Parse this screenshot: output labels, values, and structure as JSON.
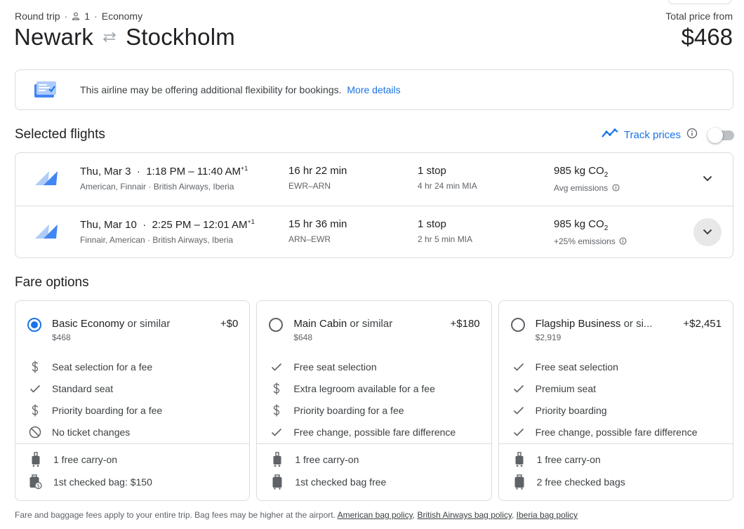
{
  "trip": {
    "type": "Round trip",
    "passengers": "1",
    "cabin": "Economy",
    "origin": "Newark",
    "destination": "Stockholm"
  },
  "price": {
    "label": "Total price from",
    "value": "$468"
  },
  "banner": {
    "text": "This airline may be offering additional flexibility for bookings.",
    "link": "More details"
  },
  "selected_flights": {
    "title": "Selected flights",
    "track_label": "Track prices",
    "track_enabled": false,
    "flights": [
      {
        "date": "Thu, Mar 3",
        "times": "1:18 PM – 11:40 AM",
        "day_offset": "+1",
        "airlines": "American, Finnair · British Airways, Iberia",
        "duration": "16 hr 22 min",
        "route": "EWR–ARN",
        "stops": "1 stop",
        "layover": "4 hr 24 min MIA",
        "emissions": "985 kg CO",
        "emissions_sub": "2",
        "emissions_note": "Avg emissions"
      },
      {
        "date": "Thu, Mar 10",
        "times": "2:25 PM – 12:01 AM",
        "day_offset": "+1",
        "airlines": "Finnair, American · British Airways, Iberia",
        "duration": "15 hr 36 min",
        "route": "ARN–EWR",
        "stops": "1 stop",
        "layover": "2 hr 5 min MIA",
        "emissions": "985 kg CO",
        "emissions_sub": "2",
        "emissions_note": "+25% emissions"
      }
    ]
  },
  "fare_options": {
    "title": "Fare options",
    "cards": [
      {
        "name": "Basic Economy",
        "suffix": "or similar",
        "price": "$468",
        "delta": "+$0",
        "selected": true,
        "features": [
          {
            "icon": "dollar-icon",
            "text": "Seat selection for a fee"
          },
          {
            "icon": "check-icon",
            "text": "Standard seat"
          },
          {
            "icon": "dollar-icon",
            "text": "Priority boarding for a fee"
          },
          {
            "icon": "no-icon",
            "text": "No ticket changes"
          }
        ],
        "bags": [
          {
            "icon": "carry-on-icon",
            "text": "1 free carry-on"
          },
          {
            "icon": "checked-bag-fee-icon",
            "text": "1st checked bag: $150"
          }
        ]
      },
      {
        "name": "Main Cabin",
        "suffix": "or similar",
        "price": "$648",
        "delta": "+$180",
        "selected": false,
        "features": [
          {
            "icon": "check-icon",
            "text": "Free seat selection"
          },
          {
            "icon": "dollar-icon",
            "text": "Extra legroom available for a fee"
          },
          {
            "icon": "dollar-icon",
            "text": "Priority boarding for a fee"
          },
          {
            "icon": "check-icon",
            "text": "Free change, possible fare difference"
          }
        ],
        "bags": [
          {
            "icon": "carry-on-icon",
            "text": "1 free carry-on"
          },
          {
            "icon": "checked-bag-icon",
            "text": "1st checked bag free"
          }
        ]
      },
      {
        "name": "Flagship Business",
        "suffix": "or si...",
        "price": "$2,919",
        "delta": "+$2,451",
        "selected": false,
        "features": [
          {
            "icon": "check-icon",
            "text": "Free seat selection"
          },
          {
            "icon": "check-icon",
            "text": "Premium seat"
          },
          {
            "icon": "check-icon",
            "text": "Priority boarding"
          },
          {
            "icon": "check-icon",
            "text": "Free change, possible fare difference"
          }
        ],
        "bags": [
          {
            "icon": "carry-on-icon",
            "text": "1 free carry-on"
          },
          {
            "icon": "checked-bag-icon",
            "text": "2 free checked bags"
          }
        ]
      }
    ]
  },
  "footer": {
    "text": "Fare and baggage fees apply to your entire trip. Bag fees may be higher at the airport.",
    "link1": "American bag policy",
    "link2": "British Airways bag policy",
    "link3": "Iberia bag policy",
    "sep": ","
  },
  "colors": {
    "accent": "#1a73e8",
    "border": "#dadce0",
    "text": "#202124",
    "muted": "#5f6368"
  }
}
